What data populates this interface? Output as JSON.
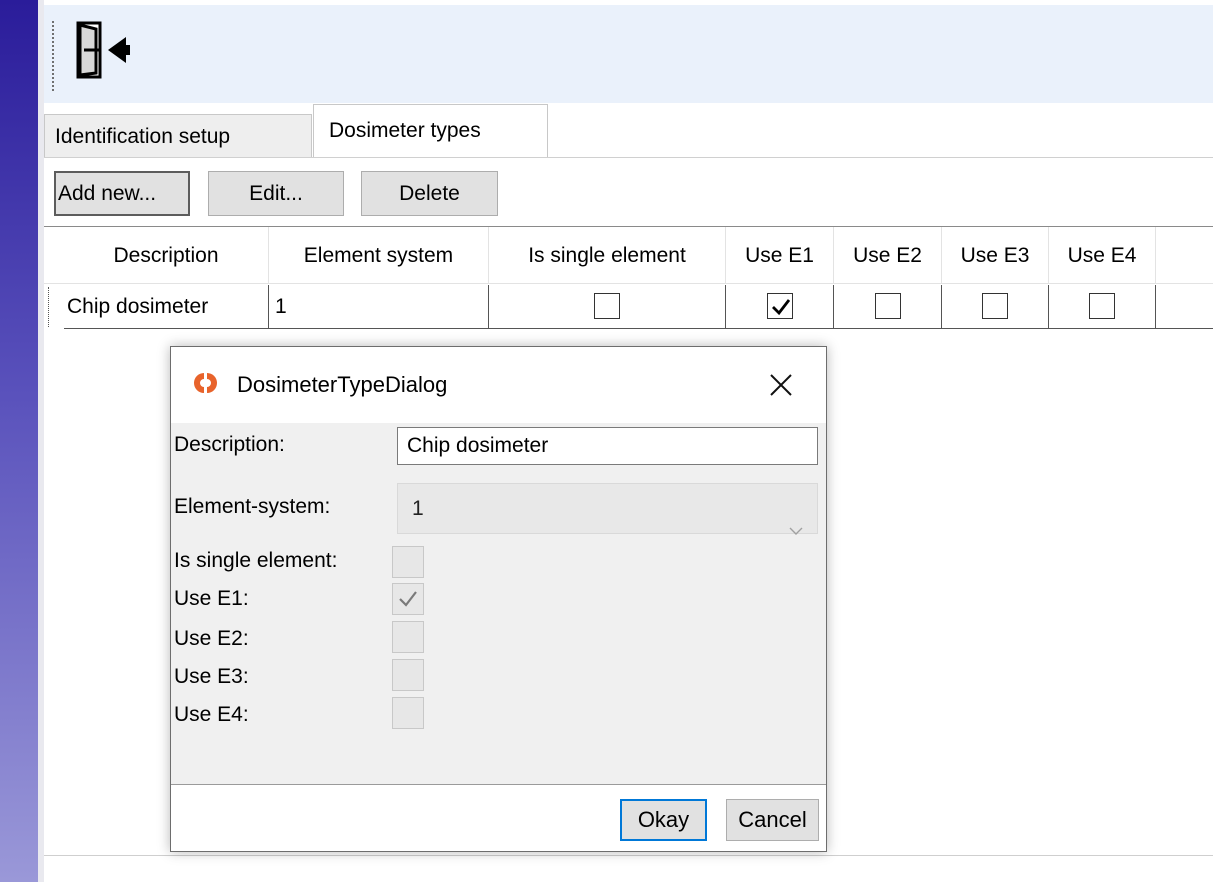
{
  "toolbar": {
    "exit_icon": "exit-door-arrow-icon"
  },
  "tabs": [
    {
      "label": "Identification setup",
      "selected": false
    },
    {
      "label": "Dosimeter types",
      "selected": true
    }
  ],
  "actions": {
    "add_label": "Add new...",
    "edit_label": "Edit...",
    "delete_label": "Delete"
  },
  "table": {
    "columns": [
      "Description",
      "Element system",
      "Is single element",
      "Use E1",
      "Use E2",
      "Use E3",
      "Use E4"
    ],
    "rows": [
      {
        "description": "Chip dosimeter",
        "element_system": "1",
        "is_single_element": false,
        "use_e1": true,
        "use_e2": false,
        "use_e3": false,
        "use_e4": false
      }
    ]
  },
  "dialog": {
    "title": "DosimeterTypeDialog",
    "description_label": "Description:",
    "description_value": "Chip dosimeter",
    "element_system_label": "Element-system:",
    "element_system_value": "1",
    "is_single_label": "Is single element:",
    "is_single_checked": false,
    "use_e1_label": "Use E1:",
    "use_e1_checked": true,
    "use_e2_label": "Use E2:",
    "use_e2_checked": false,
    "use_e3_label": "Use E3:",
    "use_e3_checked": false,
    "use_e4_label": "Use E4:",
    "use_e4_checked": false,
    "okay_label": "Okay",
    "cancel_label": "Cancel",
    "icon_color": "#e8632b"
  },
  "colors": {
    "accent_bar": "#2a1c9a",
    "toolbar_bg": "#eaf1fb",
    "focus_blue": "#0078d7"
  }
}
